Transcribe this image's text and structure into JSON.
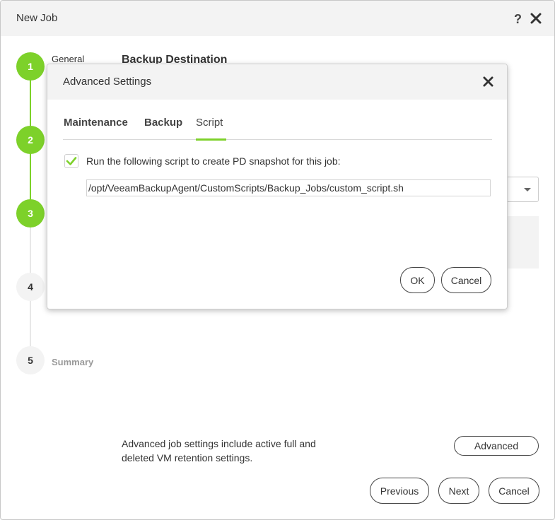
{
  "window": {
    "title": "New Job",
    "help_label": "?",
    "close_icon": "close-icon"
  },
  "steps": [
    {
      "number": "1",
      "label": "General",
      "state": "done"
    },
    {
      "number": "2",
      "label": "",
      "state": "done"
    },
    {
      "number": "3",
      "label": "",
      "state": "current"
    },
    {
      "number": "4",
      "label": "",
      "state": "pending"
    },
    {
      "number": "5",
      "label": "Summary",
      "state": "pending"
    }
  ],
  "main": {
    "section_title": "Backup Destination",
    "advanced_description": "Advanced job settings include active full and deleted VM retention settings.",
    "advanced_button": "Advanced"
  },
  "footer": {
    "previous": "Previous",
    "next": "Next",
    "cancel": "Cancel"
  },
  "dialog": {
    "title": "Advanced Settings",
    "tabs": [
      {
        "label": "Maintenance",
        "active": false
      },
      {
        "label": "Backup",
        "active": false
      },
      {
        "label": "Script",
        "active": true
      }
    ],
    "checkbox_checked": true,
    "checkbox_label": "Run the following script to create PD snapshot for this job:",
    "script_path": "/opt/VeeamBackupAgent/CustomScripts/Backup_Jobs/custom_script.sh",
    "ok": "OK",
    "cancel": "Cancel"
  },
  "colors": {
    "accent": "#7dd12a",
    "header_bg": "#f3f3f3"
  }
}
